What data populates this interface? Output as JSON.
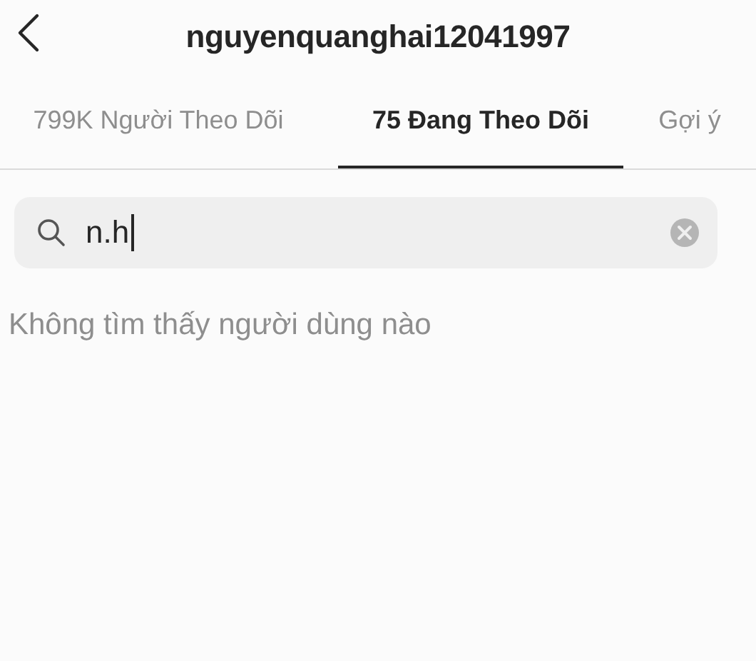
{
  "header": {
    "title": "nguyenquanghai12041997"
  },
  "tabs": [
    {
      "label": "799K Người Theo Dõi",
      "selected": false
    },
    {
      "label": "75 Đang Theo Dõi",
      "selected": true
    },
    {
      "label": "Gợi ý",
      "selected": false
    }
  ],
  "search": {
    "value": "n.h"
  },
  "message": "Không tìm thấy người dùng nào"
}
